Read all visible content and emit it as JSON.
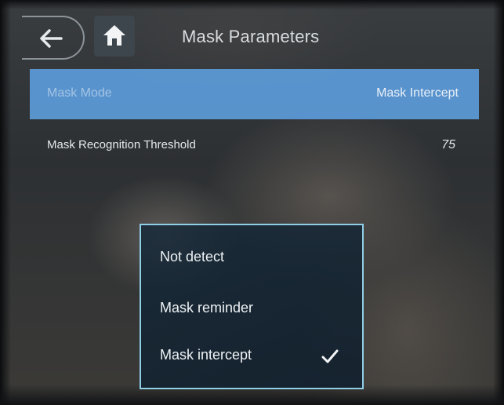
{
  "header": {
    "title": "Mask Parameters",
    "back_icon": "back-arrow-icon",
    "home_icon": "home-icon"
  },
  "settings": {
    "mask_mode": {
      "label": "Mask Mode",
      "value": "Mask Intercept"
    },
    "threshold": {
      "label": "Mask Recognition Threshold",
      "value": "75"
    }
  },
  "popup": {
    "options": [
      {
        "label": "Not detect",
        "selected": false
      },
      {
        "label": "Mask reminder",
        "selected": false
      },
      {
        "label": "Mask intercept",
        "selected": true
      }
    ],
    "check_icon": "checkmark-icon"
  },
  "colors": {
    "selected_row": "#5fa0e1",
    "popup_border": "#8fcfe6",
    "text": "#e6e8ea"
  }
}
